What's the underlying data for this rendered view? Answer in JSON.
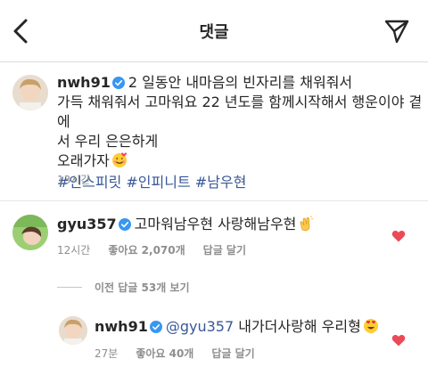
{
  "header": {
    "title": "댓글"
  },
  "caption": {
    "username": "nwh91",
    "line1": "2 일동안 내마음의 빈자리를 채워줘서",
    "line2": "가득 채워줘서 고마워요 22 년도를 함께시작해서 행운이야 곁에",
    "line3": "서 우리 은은하게",
    "line4": "오래가자",
    "hashtags": [
      "#인스피릿",
      "#인피니트",
      "#남우현"
    ],
    "time": "13시간"
  },
  "comment": {
    "username": "gyu357",
    "text": "고마워남우현 사랑해남우현",
    "time": "12시간",
    "likes": "좋아요 2,070개",
    "reply": "답글 달기"
  },
  "view_replies": "이전 답글 53개 보기",
  "reply": {
    "username": "nwh91",
    "mention": "@gyu357",
    "text": "내가더사랑해 우리형",
    "time": "27분",
    "likes": "좋아요 40개",
    "reply": "답글 달기"
  },
  "colors": {
    "heart": "#ed4956",
    "verified": "#3897f0",
    "hashtag": "#385898"
  },
  "icons": {
    "back": "chevron-left-icon",
    "send": "paper-plane-icon",
    "verified": "verified-badge-icon",
    "heart": "heart-icon"
  }
}
